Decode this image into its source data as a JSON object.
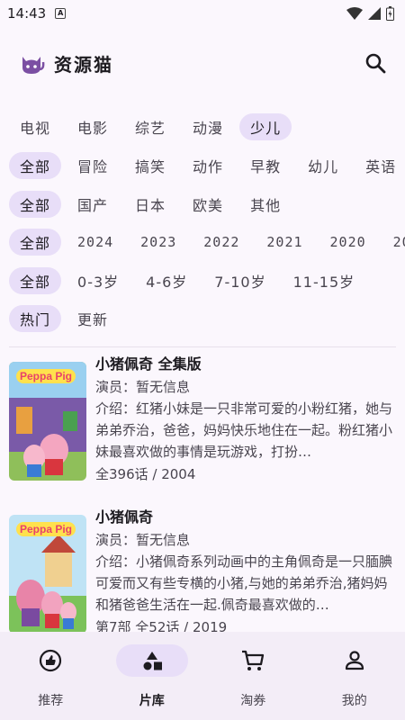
{
  "status": {
    "time": "14:43"
  },
  "app": {
    "title": "资源猫"
  },
  "filters": {
    "categories": [
      "电视",
      "电影",
      "综艺",
      "动漫",
      "少儿"
    ],
    "genres": [
      "全部",
      "冒险",
      "搞笑",
      "动作",
      "早教",
      "幼儿",
      "英语"
    ],
    "regions": [
      "全部",
      "国产",
      "日本",
      "欧美",
      "其他"
    ],
    "years": [
      "全部",
      "2024",
      "2023",
      "2022",
      "2021",
      "2020",
      "20"
    ],
    "ages": [
      "全部",
      "0-3岁",
      "4-6岁",
      "7-10岁",
      "11-15岁"
    ],
    "sort": [
      "热门",
      "更新"
    ]
  },
  "items": [
    {
      "title": "小猪佩奇 全集版",
      "actors": "演员：暂无信息",
      "intro": "介绍：红猪小妹是一只非常可爱的小粉红猪，她与弟弟乔治，爸爸，妈妈快乐地住在一起。粉红猪小妹最喜欢做的事情是玩游戏，打扮…",
      "meta": "全396话 / 2004",
      "poster_label": "Peppa Pig"
    },
    {
      "title": "小猪佩奇",
      "actors": "演员：暂无信息",
      "intro": "介绍：小猪佩奇系列动画中的主角佩奇是一只腼腆可爱而又有些专横的小猪,与她的弟弟乔治,猪妈妈和猪爸爸生活在一起.佩奇最喜欢做的…",
      "meta": "第7部 全52话 / 2019",
      "poster_label": "Peppa Pig"
    }
  ],
  "nav": [
    {
      "label": "推荐",
      "icon": "thumb-up-icon"
    },
    {
      "label": "片库",
      "icon": "library-shapes-icon"
    },
    {
      "label": "淘券",
      "icon": "cart-icon"
    },
    {
      "label": "我的",
      "icon": "person-icon"
    }
  ],
  "colors": {
    "accent_bg": "#e8def8",
    "background": "#fbf7fd",
    "nav_bg": "#f3edf7"
  }
}
